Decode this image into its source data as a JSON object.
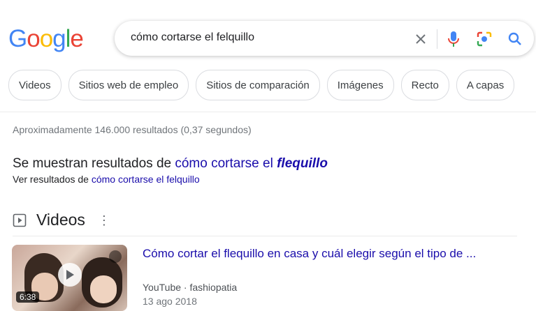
{
  "logo": {
    "letters": [
      "G",
      "o",
      "o",
      "g",
      "l",
      "e"
    ],
    "colors": [
      "#4285F4",
      "#EA4335",
      "#FBBC05",
      "#4285F4",
      "#34A853",
      "#EA4335"
    ]
  },
  "search": {
    "query": "cómo cortarse el felquillo"
  },
  "chips": [
    "Videos",
    "Sitios web de empleo",
    "Sitios de comparación",
    "Imágenes",
    "Recto",
    "A capas"
  ],
  "stats": "Aproximadamente 146.000 resultados (0,37 segundos)",
  "correction": {
    "prefix": "Se muestran resultados de ",
    "link_plain": "cómo cortarse el ",
    "link_emph": "flequillo",
    "orig_prefix": "Ver resultados de ",
    "orig_link": "cómo cortarse el felquillo"
  },
  "videos": {
    "title": "Videos",
    "items": [
      {
        "title": "Cómo cortar el flequillo en casa y cuál elegir según el tipo de ...",
        "source": "YouTube · fashiopatia",
        "date": "13 ago 2018",
        "duration": "6:38"
      }
    ]
  },
  "colors": {
    "link": "#1a0dab",
    "mic_blue": "#4285F4"
  }
}
